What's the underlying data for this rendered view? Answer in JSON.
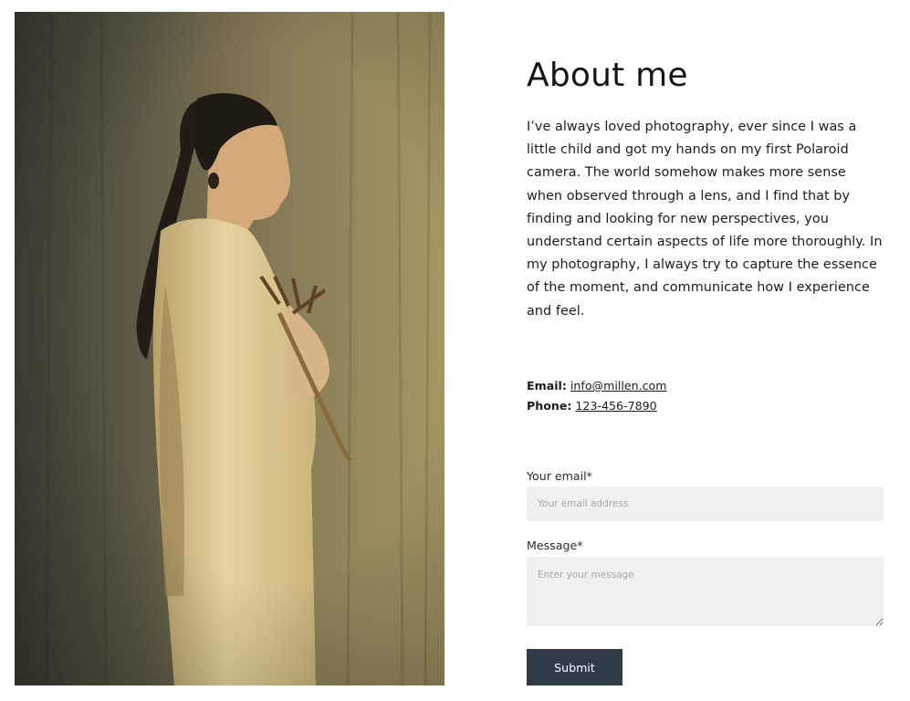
{
  "about": {
    "title": "About me",
    "bio": "I’ve always loved photography, ever since I was a little child and got my hands on my first Polaroid camera. The world somehow makes more sense when observed through a lens, and I find that by finding and looking for new perspectives, you understand certain aspects of life more thoroughly. In my photography, I always try to capture the essence of the moment, and communicate how I experience and feel."
  },
  "contact": {
    "email_label": "Email:",
    "email_value": "info@millen.com",
    "phone_label": "Phone:",
    "phone_value": "123-456-7890"
  },
  "form": {
    "email_label": "Your email*",
    "email_placeholder": "Your email address",
    "email_value": "",
    "message_label": "Message*",
    "message_placeholder": "Enter your message",
    "message_value": "",
    "submit_label": "Submit"
  },
  "colors": {
    "button_bg": "#2f3a46",
    "input_bg": "#f0f0f0",
    "text": "#1c1c1c"
  }
}
